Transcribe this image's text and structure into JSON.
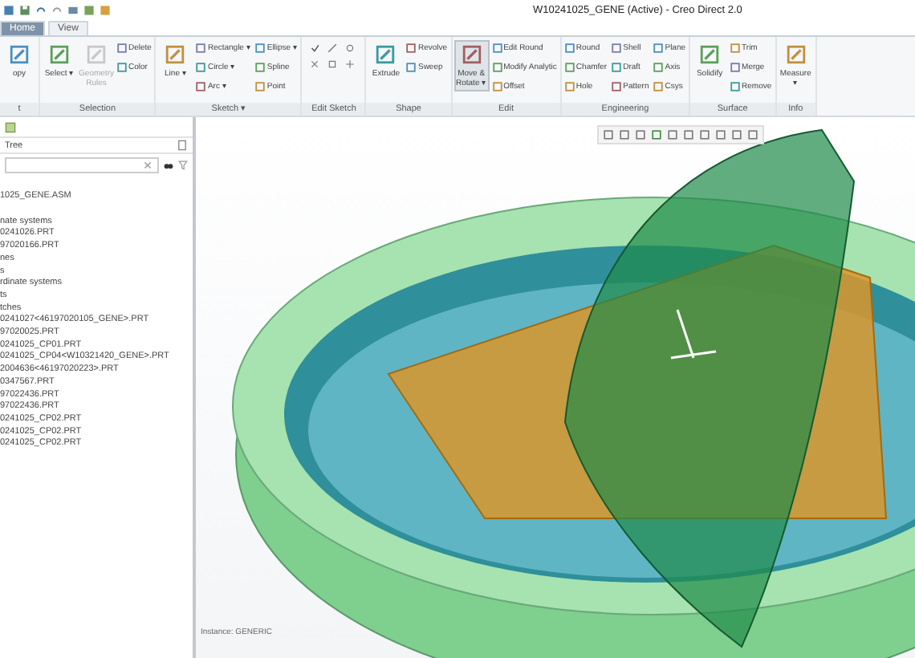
{
  "window": {
    "title": "W10241025_GENE (Active) - Creo Direct 2.0"
  },
  "tabs": [
    {
      "label": "Home",
      "selected": true
    },
    {
      "label": "View",
      "selected": false
    }
  ],
  "ribbon": [
    {
      "label": "t",
      "kind": "commands",
      "commands": [
        {
          "label": "opy",
          "kind": "large",
          "disabled": false,
          "highlighted": false
        }
      ]
    },
    {
      "label": "Selection",
      "kind": "commands",
      "commands": [
        {
          "label": "Select ▾",
          "kind": "large",
          "disabled": false,
          "highlighted": false
        },
        {
          "label": "Geometry Rules",
          "kind": "large",
          "disabled": true,
          "highlighted": false
        },
        {
          "label": "Delete",
          "kind": "small",
          "disabled": false,
          "highlighted": false
        },
        {
          "label": "Color",
          "kind": "small",
          "disabled": false,
          "highlighted": false
        }
      ]
    },
    {
      "label": "Sketch ▾",
      "kind": "commands",
      "commands": [
        {
          "label": "Line ▾",
          "kind": "large",
          "disabled": false,
          "highlighted": false
        },
        {
          "label": "Rectangle ▾",
          "kind": "small",
          "disabled": false,
          "highlighted": false
        },
        {
          "label": "Circle ▾",
          "kind": "small",
          "disabled": false,
          "highlighted": false
        },
        {
          "label": "Arc ▾",
          "kind": "small",
          "disabled": false,
          "highlighted": false
        },
        {
          "label": "Ellipse ▾",
          "kind": "small",
          "disabled": false,
          "highlighted": false
        },
        {
          "label": "Spline",
          "kind": "small",
          "disabled": false,
          "highlighted": false
        },
        {
          "label": "Point",
          "kind": "small",
          "disabled": false,
          "highlighted": false
        }
      ]
    },
    {
      "label": "Edit Sketch",
      "kind": "icons"
    },
    {
      "label": "Shape",
      "kind": "commands",
      "commands": [
        {
          "label": "Extrude",
          "kind": "large",
          "disabled": false,
          "highlighted": false
        },
        {
          "label": "Revolve",
          "kind": "small",
          "disabled": false,
          "highlighted": false
        },
        {
          "label": "Sweep",
          "kind": "small",
          "disabled": false,
          "highlighted": false
        }
      ]
    },
    {
      "label": "Edit",
      "kind": "commands",
      "commands": [
        {
          "label": "Move & Rotate ▾",
          "kind": "large",
          "disabled": false,
          "highlighted": true
        },
        {
          "label": "Edit Round",
          "kind": "small",
          "disabled": false,
          "highlighted": false
        },
        {
          "label": "Modify Analytic",
          "kind": "small",
          "disabled": false,
          "highlighted": false
        },
        {
          "label": "Offset",
          "kind": "small",
          "disabled": false,
          "highlighted": false
        }
      ]
    },
    {
      "label": "Engineering",
      "kind": "commands",
      "commands": [
        {
          "label": "Round",
          "kind": "small",
          "disabled": false,
          "highlighted": false
        },
        {
          "label": "Chamfer",
          "kind": "small",
          "disabled": false,
          "highlighted": false
        },
        {
          "label": "Hole",
          "kind": "small",
          "disabled": false,
          "highlighted": false
        },
        {
          "label": "Shell",
          "kind": "small",
          "disabled": false,
          "highlighted": false
        },
        {
          "label": "Draft",
          "kind": "small",
          "disabled": false,
          "highlighted": false
        },
        {
          "label": "Pattern",
          "kind": "small",
          "disabled": false,
          "highlighted": false
        },
        {
          "label": "Plane",
          "kind": "small",
          "disabled": false,
          "highlighted": false
        },
        {
          "label": "Axis",
          "kind": "small",
          "disabled": false,
          "highlighted": false
        },
        {
          "label": "Csys",
          "kind": "small",
          "disabled": false,
          "highlighted": false
        }
      ]
    },
    {
      "label": "Surface",
      "kind": "commands",
      "commands": [
        {
          "label": "Solidify",
          "kind": "large",
          "disabled": false,
          "highlighted": false
        },
        {
          "label": "Trim",
          "kind": "small",
          "disabled": false,
          "highlighted": false
        },
        {
          "label": "Merge",
          "kind": "small",
          "disabled": false,
          "highlighted": false
        },
        {
          "label": "Remove",
          "kind": "small",
          "disabled": false,
          "highlighted": false
        }
      ]
    },
    {
      "label": "Info",
      "kind": "commands",
      "commands": [
        {
          "label": "Measure ▾",
          "kind": "large",
          "disabled": false,
          "highlighted": false
        }
      ]
    }
  ],
  "model_tree": {
    "title": "Tree",
    "items": [
      {
        "label": "1025_GENE.ASM"
      },
      {
        "label": "nate systems"
      },
      {
        "label": "0241026.PRT"
      },
      {
        "label": "97020166.PRT"
      },
      {
        "label": "nes"
      },
      {
        "label": "s"
      },
      {
        "label": "rdinate systems"
      },
      {
        "label": "ts"
      },
      {
        "label": "tches"
      },
      {
        "label": "0241027<46197020105_GENE>.PRT"
      },
      {
        "label": "97020025.PRT"
      },
      {
        "label": "0241025_CP01.PRT"
      },
      {
        "label": "0241025_CP04<W10321420_GENE>.PRT"
      },
      {
        "label": "2004636<46197020223>.PRT"
      },
      {
        "label": "0347567.PRT"
      },
      {
        "label": "97022436.PRT"
      },
      {
        "label": "97022436.PRT"
      },
      {
        "label": "0241025_CP02.PRT"
      },
      {
        "label": "0241025_CP02.PRT"
      },
      {
        "label": "0241025_CP02.PRT"
      }
    ]
  },
  "viewport": {
    "instance_label": "Instance: GENERIC"
  }
}
